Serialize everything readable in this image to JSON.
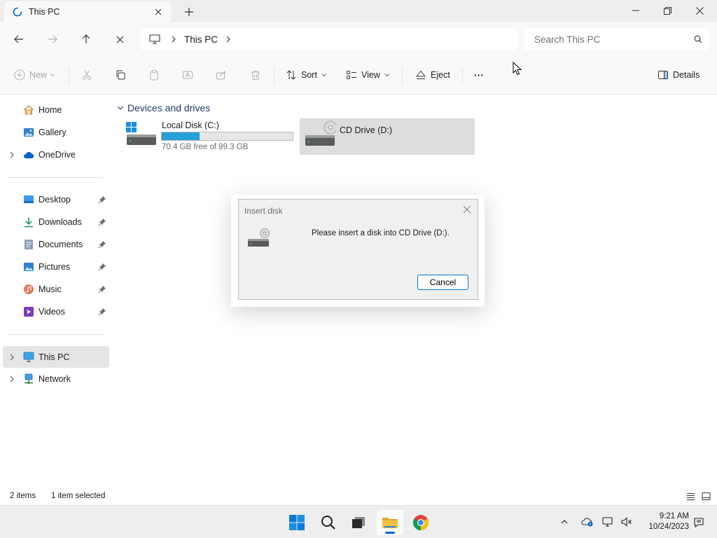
{
  "tab": {
    "title": "This PC"
  },
  "address": {
    "location": "This PC"
  },
  "search": {
    "placeholder": "Search This PC"
  },
  "commands": {
    "new": "New",
    "sort": "Sort",
    "view": "View",
    "eject": "Eject",
    "more": "···",
    "details": "Details"
  },
  "sidebar": {
    "quick": [
      {
        "label": "Home"
      },
      {
        "label": "Gallery"
      },
      {
        "label": "OneDrive"
      }
    ],
    "pinned": [
      {
        "label": "Desktop"
      },
      {
        "label": "Downloads"
      },
      {
        "label": "Documents"
      },
      {
        "label": "Pictures"
      },
      {
        "label": "Music"
      },
      {
        "label": "Videos"
      }
    ],
    "locations": [
      {
        "label": "This PC"
      },
      {
        "label": "Network"
      }
    ]
  },
  "content": {
    "group_title": "Devices and drives",
    "drives": [
      {
        "name": "Local Disk (C:)",
        "free_text": "70.4 GB free of 99.3 GB",
        "used_fraction": 0.291
      },
      {
        "name": "CD Drive (D:)"
      }
    ]
  },
  "dialog": {
    "title": "Insert disk",
    "message": "Please insert a disk into CD Drive (D:).",
    "cancel": "Cancel"
  },
  "status": {
    "items": "2 items",
    "selected": "1 item selected"
  },
  "clock": {
    "time": "9:21 AM",
    "date": "10/24/2023"
  },
  "colors": {
    "accent": "#0067c0",
    "progress": "#26a0da",
    "folder": "#f5c243"
  }
}
